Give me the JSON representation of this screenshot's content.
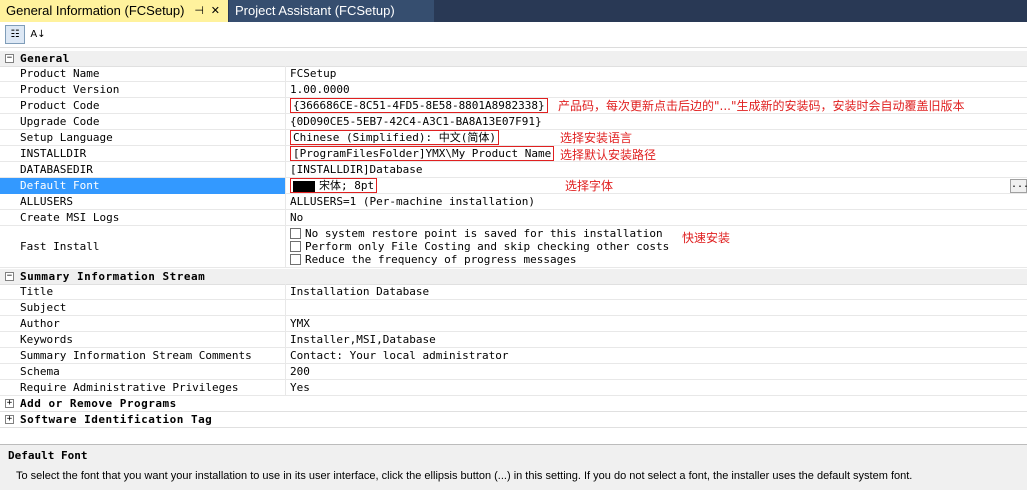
{
  "tabs": [
    {
      "label": "General Information (FCSetup)",
      "pin_glyph": "⊣",
      "close_glyph": "✕",
      "active": true
    },
    {
      "label": "Project Assistant (FCSetup)",
      "active": false
    }
  ],
  "toolbar": {
    "categorized_glyph": "☷",
    "alphabetical_glyph": "A↓"
  },
  "categories": {
    "general": {
      "label": "General",
      "expander": "−"
    },
    "summary": {
      "label": "Summary Information Stream",
      "expander": "−"
    },
    "add_remove": {
      "label": "Add or Remove Programs",
      "expander": "+"
    },
    "software_id": {
      "label": "Software Identification Tag",
      "expander": "+"
    }
  },
  "general": {
    "product_name": {
      "label": "Product Name",
      "value": "FCSetup"
    },
    "product_version": {
      "label": "Product Version",
      "value": "1.00.0000"
    },
    "product_code": {
      "label": "Product Code",
      "value": "{366686CE-8C51-4FD5-8E58-8801A8982338}"
    },
    "upgrade_code": {
      "label": "Upgrade Code",
      "value": "{0D090CE5-5EB7-42C4-A3C1-BA8A13E07F91}"
    },
    "setup_language": {
      "label": "Setup Language",
      "value": "Chinese (Simplified): 中文(简体)"
    },
    "installdir": {
      "label": "INSTALLDIR",
      "value": "[ProgramFilesFolder]YMX\\My Product Name"
    },
    "databasedir": {
      "label": "DATABASEDIR",
      "value": "[INSTALLDIR]Database"
    },
    "default_font": {
      "label": "Default Font",
      "value": "宋体; 8pt",
      "ellipsis": "..."
    },
    "allusers": {
      "label": "ALLUSERS",
      "value": "ALLUSERS=1 (Per-machine installation)"
    },
    "create_msi_logs": {
      "label": "Create MSI Logs",
      "value": "No"
    },
    "fast_install": {
      "label": "Fast Install",
      "options": [
        "No system restore point is saved for this installation",
        "Perform only File Costing and skip checking other costs",
        "Reduce the frequency of progress messages"
      ]
    }
  },
  "summary": {
    "title": {
      "label": "Title",
      "value": "Installation Database"
    },
    "subject": {
      "label": "Subject",
      "value": ""
    },
    "author": {
      "label": "Author",
      "value": "YMX"
    },
    "keywords": {
      "label": "Keywords",
      "value": "Installer,MSI,Database"
    },
    "comments": {
      "label": "Summary Information Stream Comments",
      "value": "Contact:  Your local administrator"
    },
    "schema": {
      "label": "Schema",
      "value": "200"
    },
    "admin": {
      "label": "Require Administrative Privileges",
      "value": "Yes"
    }
  },
  "annotations": {
    "product_code": "产品码，每次更新点击后边的\"...\"生成新的安装码，安装时会自动覆盖旧版本",
    "language": "选择安装语言",
    "path": "选择默认安装路径",
    "font": "选择字体",
    "fast": "快速安装"
  },
  "description": {
    "title": "Default Font",
    "text": "To select the font that you want your installation to use in its user interface, click the ellipsis button (...) in this setting. If you do not select a font, the installer uses the default system font."
  },
  "colors": {
    "selection": "#3399ff",
    "active_tab": "#fff29d",
    "tab_bar": "#293955",
    "annotation": "#e02020"
  }
}
